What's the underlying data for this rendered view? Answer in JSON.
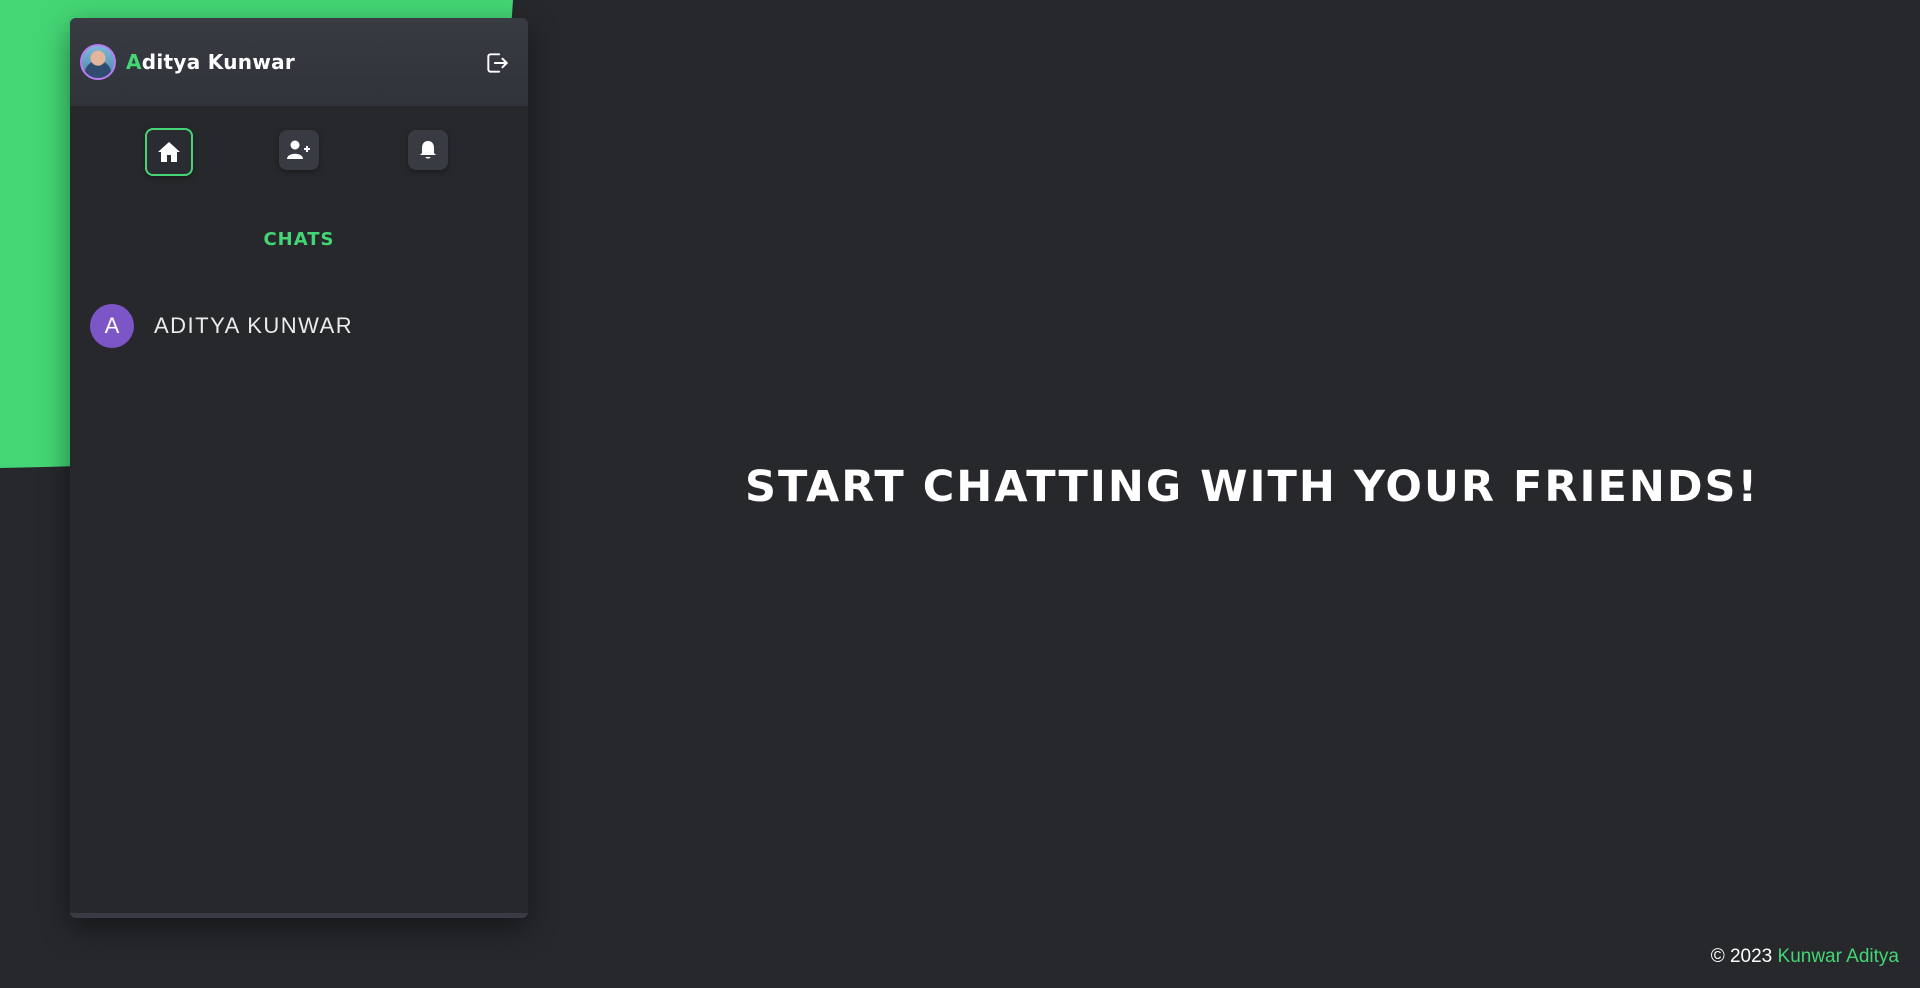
{
  "colors": {
    "accent": "#44d675",
    "background": "#27282c",
    "panel_header": "#383b42",
    "chat_avatar": "#7c55c7"
  },
  "header": {
    "user_name_first_letter": "A",
    "user_name_rest": "ditya Kunwar",
    "logout_icon": "logout-icon"
  },
  "nav": {
    "items": [
      {
        "icon": "home-icon",
        "active": true
      },
      {
        "icon": "add-user-icon",
        "active": false
      },
      {
        "icon": "bell-icon",
        "active": false
      }
    ]
  },
  "chats": {
    "title": "CHATS",
    "items": [
      {
        "initial": "A",
        "name": "ADITYA KUNWAR"
      }
    ]
  },
  "main": {
    "hero_text": "START CHATTING WITH YOUR FRIENDS!"
  },
  "footer": {
    "copyright": "© 2023",
    "author": "Kunwar Aditya"
  }
}
